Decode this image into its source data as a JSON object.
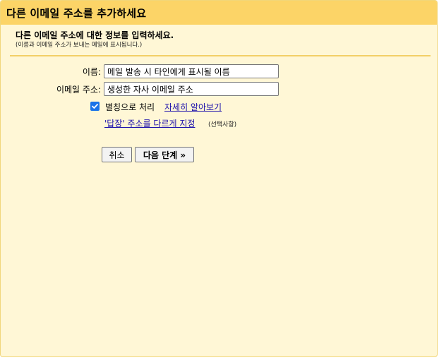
{
  "dialog": {
    "title": "다른 이메일 주소를 추가하세요",
    "heading": "다른 이메일 주소에 대한 정보를 입력하세요.",
    "subheading": "(이름과 이메일 주소가 보내는 메일에 표시됩니다.)"
  },
  "form": {
    "name_label": "이름:",
    "name_value": "메일 발송 시 타인에게 표시될 이름",
    "email_label": "이메일 주소:",
    "email_value": "생성한 자사 이메일 주소",
    "alias_checkbox_label": "별칭으로 처리",
    "alias_checked": true,
    "learn_more_link": "자세히 알아보기",
    "reply_to_link": "'답장' 주소를 다르게 지정",
    "reply_to_optional": "(선택사항)"
  },
  "buttons": {
    "cancel_label": "취소",
    "next_label": "다음 단계 »"
  }
}
